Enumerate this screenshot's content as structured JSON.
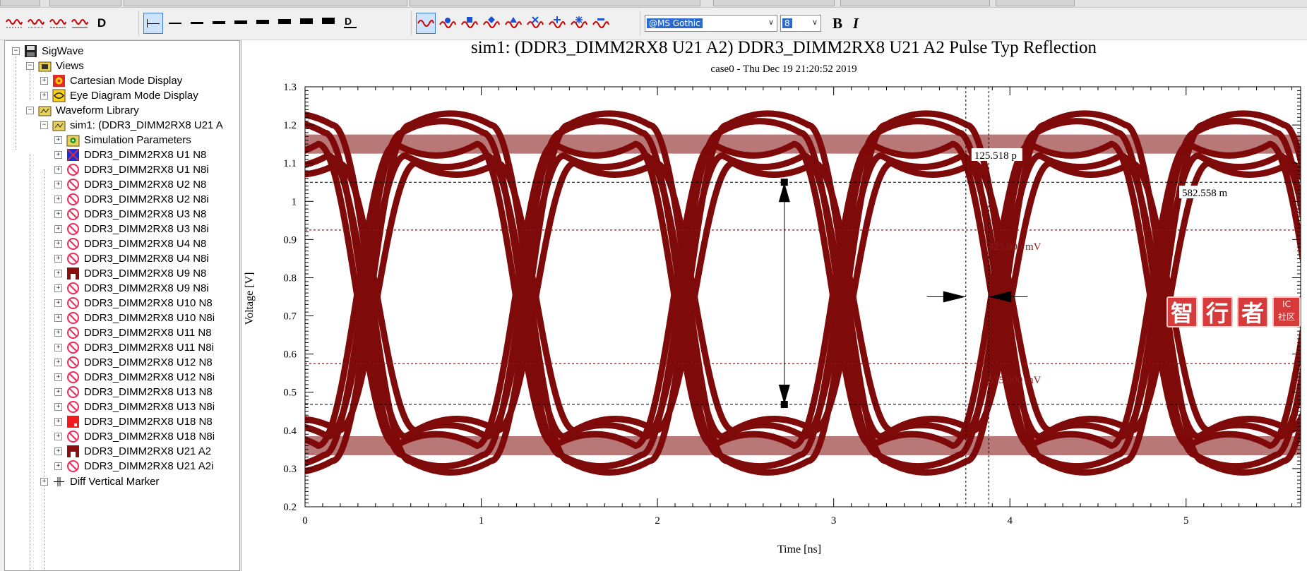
{
  "toolbar": {
    "font_name": "@MS Gothic",
    "font_size": "8",
    "bold_label": "B",
    "italic_label": "I",
    "text_icon_label": "D"
  },
  "tree": {
    "root": "SigWave",
    "views_label": "Views",
    "view_items": [
      "Cartesian Mode Display",
      "Eye Diagram Mode Display"
    ],
    "library_label": "Waveform Library",
    "sim_label": "sim1: (DDR3_DIMM2RX8 U21 A",
    "sim_params": "Simulation Parameters",
    "waveforms": [
      {
        "label": "DDR3_DIMM2RX8 U1 N8",
        "icon": "blue-square-icon"
      },
      {
        "label": "DDR3_DIMM2RX8 U1 N8i",
        "icon": "hidden-waveform-icon"
      },
      {
        "label": "DDR3_DIMM2RX8 U2 N8",
        "icon": "hidden-waveform-icon"
      },
      {
        "label": "DDR3_DIMM2RX8 U2 N8i",
        "icon": "hidden-waveform-icon"
      },
      {
        "label": "DDR3_DIMM2RX8 U3 N8",
        "icon": "hidden-waveform-icon"
      },
      {
        "label": "DDR3_DIMM2RX8 U3 N8i",
        "icon": "hidden-waveform-icon"
      },
      {
        "label": "DDR3_DIMM2RX8 U4 N8",
        "icon": "hidden-waveform-icon"
      },
      {
        "label": "DDR3_DIMM2RX8 U4 N8i",
        "icon": "hidden-waveform-icon"
      },
      {
        "label": "DDR3_DIMM2RX8 U9 N8",
        "icon": "darkred-square-icon"
      },
      {
        "label": "DDR3_DIMM2RX8 U9 N8i",
        "icon": "hidden-waveform-icon"
      },
      {
        "label": "DDR3_DIMM2RX8 U10 N8",
        "icon": "hidden-waveform-icon"
      },
      {
        "label": "DDR3_DIMM2RX8 U10 N8i",
        "icon": "hidden-waveform-icon"
      },
      {
        "label": "DDR3_DIMM2RX8 U11 N8",
        "icon": "hidden-waveform-icon"
      },
      {
        "label": "DDR3_DIMM2RX8 U11 N8i",
        "icon": "hidden-waveform-icon"
      },
      {
        "label": "DDR3_DIMM2RX8 U12 N8",
        "icon": "hidden-waveform-icon"
      },
      {
        "label": "DDR3_DIMM2RX8 U12 N8i",
        "icon": "hidden-waveform-icon"
      },
      {
        "label": "DDR3_DIMM2RX8 U13 N8",
        "icon": "hidden-waveform-icon"
      },
      {
        "label": "DDR3_DIMM2RX8 U13 N8i",
        "icon": "hidden-waveform-icon"
      },
      {
        "label": "DDR3_DIMM2RX8 U18 N8",
        "icon": "red-square-icon"
      },
      {
        "label": "DDR3_DIMM2RX8 U18 N8i",
        "icon": "hidden-waveform-icon"
      },
      {
        "label": "DDR3_DIMM2RX8 U21 A2",
        "icon": "darkred-square-icon"
      },
      {
        "label": "DDR3_DIMM2RX8 U21 A2i",
        "icon": "hidden-waveform-icon"
      }
    ],
    "diff_marker": "Diff Vertical Marker"
  },
  "chart_data": {
    "type": "line",
    "title": "sim1: (DDR3_DIMM2RX8 U21 A2) DDR3_DIMM2RX8 U21 A2 Pulse Typ Reflection",
    "subtitle": "case0 - Thu Dec 19 21:20:52 2019",
    "xlabel": "Time [ns]",
    "ylabel": "Voltage [V]",
    "xlim": [
      0,
      5.65
    ],
    "ylim": [
      0.2,
      1.3
    ],
    "x_ticks": [
      "0",
      "1",
      "2",
      "3",
      "4",
      "5"
    ],
    "y_ticks": [
      "0.2",
      "0.3",
      "0.4",
      "0.5",
      "0.6",
      "0.7",
      "0.8",
      "0.9",
      "1",
      "1.1",
      "1.2",
      "1.3"
    ],
    "grid": false,
    "series": [
      {
        "color": "#7f0a0a",
        "style": "eye-diagram",
        "high_level": 1.15,
        "low_level": 0.36,
        "crossing_level": 0.75,
        "unit_interval": 0.9
      }
    ],
    "reference_lines": [
      {
        "y": 0.925,
        "label": "925.000 mV",
        "color": "#8b1a1a",
        "style": "dashed"
      },
      {
        "y": 0.575,
        "label": "575.000 mV",
        "color": "#8b1a1a",
        "style": "dashed"
      }
    ],
    "markers": {
      "horizontal_black": [
        1.05,
        0.468
      ],
      "vertical_black": [
        3.75,
        3.88
      ],
      "eye_height_label": "582.558 m",
      "eye_width_label": "125.518 p",
      "eye_height_x": 2.72
    }
  },
  "watermark": {
    "chars": [
      "智",
      "行",
      "者"
    ],
    "small_top": "IC",
    "small_bottom": "社区"
  }
}
